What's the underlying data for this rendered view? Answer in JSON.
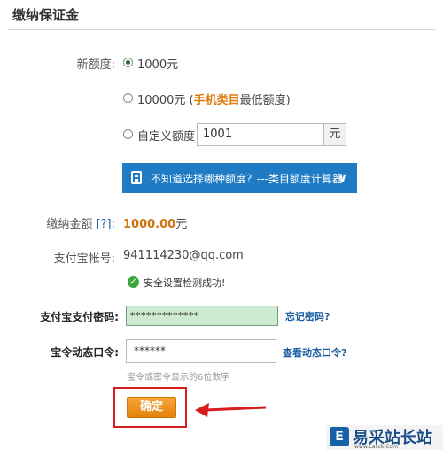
{
  "header": {
    "title": "缴纳保证金"
  },
  "form": {
    "new_quota_label": "新额度:",
    "options": [
      {
        "label": "1000元",
        "checked": true
      },
      {
        "prefix": "10000元 (",
        "highlight": "手机类目",
        "suffix": "最低额度)",
        "checked": false
      },
      {
        "label": "自定义额度",
        "checked": false
      }
    ],
    "custom_value": "1001",
    "custom_unit": "元",
    "calculator_label": "不知道选择哪种额度？---类目额度计算器",
    "amount_label": "缴纳金额",
    "amount_help": "[?]:",
    "amount_value": "1000.00",
    "amount_unit": "元",
    "account_label": "支付宝帐号:",
    "account_value": "941114230@qq.com",
    "security_ok": "安全设置检测成功!",
    "password_label": "支付宝支付密码:",
    "password_value": "*************",
    "forgot_password": "忘记密码?",
    "dynamic_label": "宝令动态口令:",
    "dynamic_value": "******",
    "view_dynamic": "查看动态口令?",
    "dynamic_hint": "宝令或密令显示的6位数字",
    "confirm_label": "确定"
  },
  "watermark": {
    "logo": "E",
    "name": "易采站长站",
    "url": "www.Easck.Com"
  },
  "colors": {
    "accent": "#1f7bc4",
    "button": "#f08d1c",
    "highlight": "#d61c1c"
  }
}
